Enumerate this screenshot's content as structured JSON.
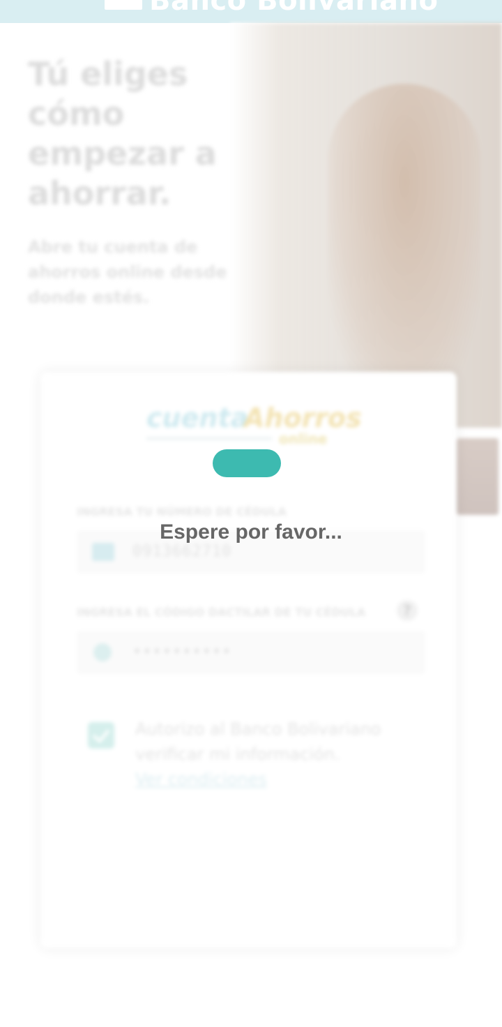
{
  "header": {
    "brand_name": "Banco Bolivariano"
  },
  "hero": {
    "title": "Tú eliges cómo empezar a ahorrar.",
    "subtitle": "Abre tu cuenta de ahorros online desde donde estés."
  },
  "product_logo": {
    "part1": "cuenta",
    "part2": "Ahorros",
    "part3": "online"
  },
  "form": {
    "cedula_label": "INGRESA TU NÚMERO DE CÉDULA",
    "cedula_value": "0913662710",
    "dactilar_label": "INGRESA EL CÓDIGO DACTILAR DE TU CÉDULA",
    "dactilar_value": "••••••••••",
    "help_symbol": "?",
    "consent_text": "Autorizo al Banco Bolivariano verificar mi información.",
    "consent_link": "Ver condiciones",
    "consent_checked": true
  },
  "overlay": {
    "message": "Espere por favor..."
  },
  "colors": {
    "header_bg": "#d9eef2",
    "accent": "#3dbab0",
    "overlay_text": "#666666"
  }
}
